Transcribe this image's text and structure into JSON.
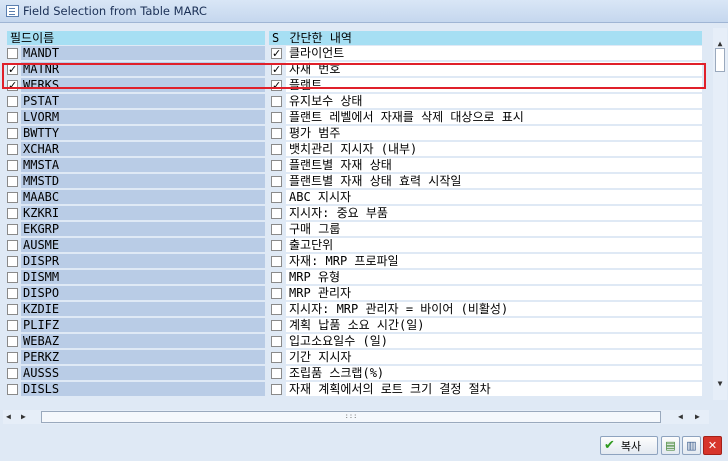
{
  "window": {
    "title": "Field Selection from Table MARC"
  },
  "table": {
    "headers": {
      "field_name": "필드이름",
      "s": "S",
      "short_desc": "간단한 내역"
    },
    "rows": [
      {
        "field": "MANDT",
        "selected": false,
        "shown": true,
        "desc": "클라이언트"
      },
      {
        "field": "MATNR",
        "selected": true,
        "shown": true,
        "desc": "자재 번호"
      },
      {
        "field": "WERKS",
        "selected": true,
        "shown": true,
        "desc": "플랜트"
      },
      {
        "field": "PSTAT",
        "selected": false,
        "shown": false,
        "desc": "유지보수 상태"
      },
      {
        "field": "LVORM",
        "selected": false,
        "shown": false,
        "desc": "플랜트 레벨에서 자재를 삭제 대상으로 표시"
      },
      {
        "field": "BWTTY",
        "selected": false,
        "shown": false,
        "desc": "평가 범주"
      },
      {
        "field": "XCHAR",
        "selected": false,
        "shown": false,
        "desc": "뱃치관리 지시자 (내부)"
      },
      {
        "field": "MMSTA",
        "selected": false,
        "shown": false,
        "desc": "플랜트별 자재 상태"
      },
      {
        "field": "MMSTD",
        "selected": false,
        "shown": false,
        "desc": "플랜트별 자재 상태 효력 시작일"
      },
      {
        "field": "MAABC",
        "selected": false,
        "shown": false,
        "desc": "ABC 지시자"
      },
      {
        "field": "KZKRI",
        "selected": false,
        "shown": false,
        "desc": "지시자: 중요 부품"
      },
      {
        "field": "EKGRP",
        "selected": false,
        "shown": false,
        "desc": "구매 그룹"
      },
      {
        "field": "AUSME",
        "selected": false,
        "shown": false,
        "desc": "출고단위"
      },
      {
        "field": "DISPR",
        "selected": false,
        "shown": false,
        "desc": "자재: MRP 프로파일"
      },
      {
        "field": "DISMM",
        "selected": false,
        "shown": false,
        "desc": "MRP 유형"
      },
      {
        "field": "DISPO",
        "selected": false,
        "shown": false,
        "desc": "MRP 관리자"
      },
      {
        "field": "KZDIE",
        "selected": false,
        "shown": false,
        "desc": "지시자: MRP 관리자 = 바이어 (비활성)"
      },
      {
        "field": "PLIFZ",
        "selected": false,
        "shown": false,
        "desc": "계획 납품 소요 시간(일)"
      },
      {
        "field": "WEBAZ",
        "selected": false,
        "shown": false,
        "desc": "입고소요일수 (일)"
      },
      {
        "field": "PERKZ",
        "selected": false,
        "shown": false,
        "desc": "기간 지시자"
      },
      {
        "field": "AUSSS",
        "selected": false,
        "shown": false,
        "desc": "조립품 스크랩(%)"
      },
      {
        "field": "DISLS",
        "selected": false,
        "shown": false,
        "desc": "자재 계획에서의 로트 크기 결정 절차"
      }
    ]
  },
  "footer": {
    "copy_label": "복사"
  },
  "colors": {
    "highlight": "#e0202a",
    "header_bg": "#a6dff3",
    "field_bg": "#b9cce6"
  }
}
